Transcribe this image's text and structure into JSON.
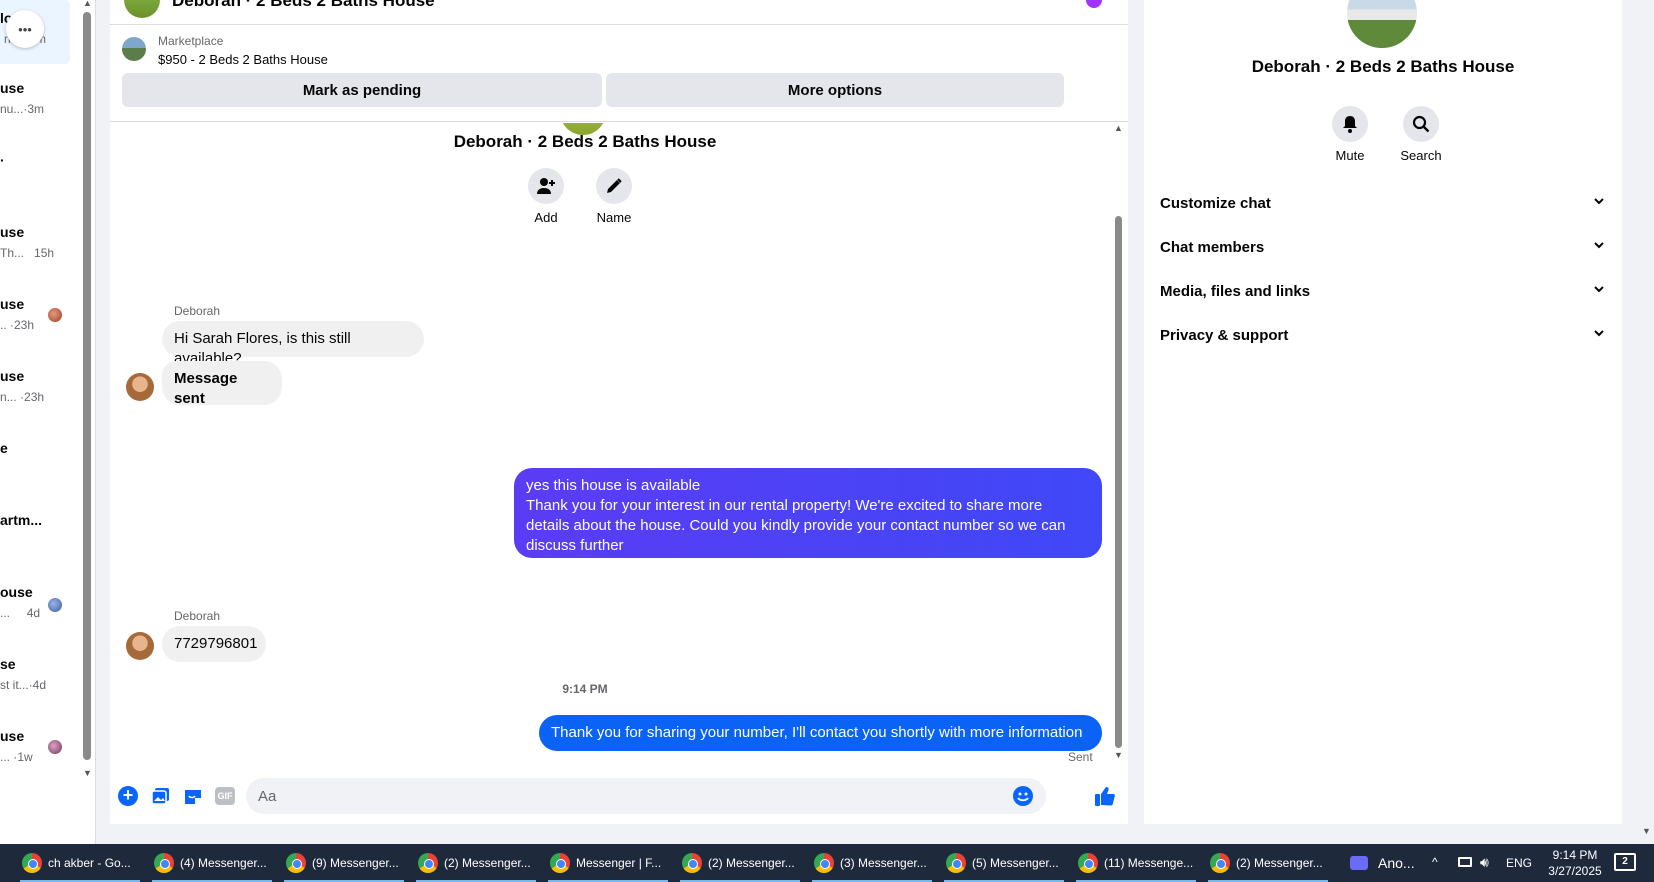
{
  "sidebar": {
    "items": [
      {
        "title": "lo",
        "sub": "n...",
        "time": "m"
      },
      {
        "title": "use",
        "sub": "nu...",
        "time": "·3m"
      },
      {
        "title": "use",
        "sub": "Th...",
        "time": "15h"
      },
      {
        "title": "use",
        "sub": "..",
        "time": "·23h"
      },
      {
        "title": "use",
        "sub": "n...",
        "time": "·23h"
      },
      {
        "title": "e",
        "sub": "",
        "time": ""
      },
      {
        "title": "artm...",
        "sub": "",
        "time": ""
      },
      {
        "title": "ouse",
        "sub": "...",
        "time": "4d"
      },
      {
        "title": "se",
        "sub": "st it...",
        "time": "·4d"
      },
      {
        "title": "use",
        "sub": "...",
        "time": "·1w"
      }
    ],
    "more_glyph": "•••"
  },
  "header": {
    "title": "Deborah · 2 Beds 2 Baths House"
  },
  "marketplace": {
    "label": "Marketplace",
    "listing": "$950 - 2 Beds 2 Baths House",
    "mark_pending": "Mark as pending",
    "more_options": "More options"
  },
  "chat": {
    "title": "Deborah · 2 Beds 2 Baths House",
    "add_label": "Add",
    "name_label": "Name",
    "messages": [
      {
        "sender": "Deborah",
        "text": "Hi Sarah Flores, is this still available?"
      },
      {
        "text": "Message sent"
      },
      {
        "lines": [
          "yes this house is available",
          "Thank you for your interest in our rental property! We're excited to share more",
          "details about the house. Could you kindly provide your contact number so we can",
          "discuss further"
        ]
      },
      {
        "sender": "Deborah",
        "text": "7729796801"
      },
      {
        "text": "Thank you for sharing your number, I'll contact you shortly with more information",
        "status": "Sent"
      }
    ],
    "timestamp": "9:14 PM"
  },
  "composer": {
    "placeholder": "Aa",
    "gif": "GIF"
  },
  "details": {
    "title": "Deborah · 2 Beds 2 Baths House",
    "mute": "Mute",
    "search": "Search",
    "sections": [
      "Customize chat",
      "Chat members",
      "Media, files and links",
      "Privacy & support"
    ]
  },
  "taskbar": {
    "tabs": [
      "ch akber - Go...",
      "(4) Messenger...",
      "(9) Messenger...",
      "(2) Messenger...",
      "Messenger | F...",
      "(2) Messenger...",
      "(3) Messenger...",
      "(5) Messenger...",
      "(11) Messenge...",
      "(2) Messenger..."
    ],
    "zoom_app": "Ano...",
    "lang": "ENG",
    "time": "9:14 PM",
    "date": "3/27/2025",
    "notif_count": "2"
  },
  "colors": {
    "accent": "#0866ff",
    "bubble_grad_start": "#5b3cf5",
    "bubble_grad_end": "#3f48f7",
    "bubble_blue": "#0a63f5"
  }
}
